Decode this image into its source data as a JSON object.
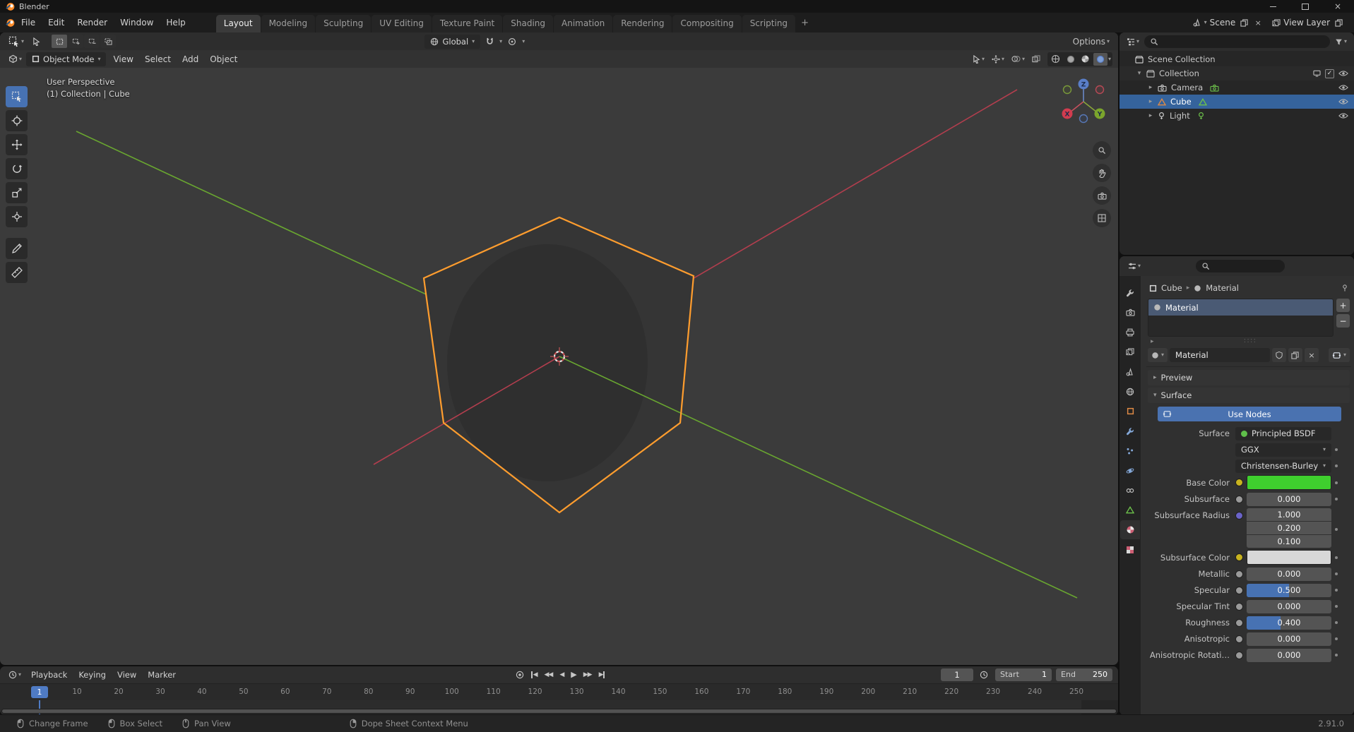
{
  "titlebar": {
    "app_title": "Blender"
  },
  "menubar": {
    "menus": [
      "File",
      "Edit",
      "Render",
      "Window",
      "Help"
    ],
    "workspaces": [
      "Layout",
      "Modeling",
      "Sculpting",
      "UV Editing",
      "Texture Paint",
      "Shading",
      "Animation",
      "Rendering",
      "Compositing",
      "Scripting"
    ],
    "active_workspace": "Layout",
    "add_workspace_label": "+",
    "scene_selector": {
      "value": "Scene"
    },
    "view_layer_selector": {
      "value": "View Layer"
    }
  },
  "tool_settings": {
    "orientation_label": "Global",
    "options_label": "Options"
  },
  "viewport": {
    "header": {
      "mode": "Object Mode",
      "menus": [
        "View",
        "Select",
        "Add",
        "Object"
      ]
    },
    "overlay_line1": "User Perspective",
    "overlay_line2": "(1) Collection | Cube",
    "gizmo_axes": {
      "x": "X",
      "y": "Y",
      "z": "Z"
    },
    "colors": {
      "background": "#3b3b3b",
      "selection_outline": "#ff9d2e",
      "axis_x": "#b33e4e",
      "axis_y": "#69a630",
      "cube_fill": "#353535"
    }
  },
  "toolbar_tools": [
    {
      "name": "select",
      "active": true
    },
    {
      "name": "cursor",
      "active": false
    },
    {
      "name": "move",
      "active": false
    },
    {
      "name": "rotate",
      "active": false
    },
    {
      "name": "scale",
      "active": false
    },
    {
      "name": "transform",
      "active": false
    },
    {
      "name": "annotate",
      "active": false
    },
    {
      "name": "measure",
      "active": false
    }
  ],
  "outliner": {
    "search_placeholder": "",
    "rows": [
      {
        "label": "Scene Collection",
        "icon": "scene-collection",
        "indent": 0,
        "disclosure": "",
        "selected": false,
        "checkbox": false,
        "screen": false,
        "eye": false
      },
      {
        "label": "Collection",
        "icon": "collection",
        "indent": 1,
        "disclosure": "▾",
        "selected": false,
        "checkbox": true,
        "screen": true,
        "eye": true
      },
      {
        "label": "Camera",
        "icon": "camera",
        "data_icon": "camera-data",
        "indent": 2,
        "disclosure": "▸",
        "selected": false,
        "checkbox": false,
        "screen": false,
        "eye": true
      },
      {
        "label": "Cube",
        "icon": "mesh",
        "data_icon": "mesh-data",
        "indent": 2,
        "disclosure": "▸",
        "selected": true,
        "checkbox": false,
        "screen": false,
        "eye": true
      },
      {
        "label": "Light",
        "icon": "light",
        "data_icon": "light-data",
        "indent": 2,
        "disclosure": "▸",
        "selected": false,
        "checkbox": false,
        "screen": false,
        "eye": true
      }
    ]
  },
  "properties": {
    "search_placeholder": "",
    "tabs": [
      {
        "name": "tool",
        "active": false
      },
      {
        "name": "render",
        "active": false
      },
      {
        "name": "output",
        "active": false
      },
      {
        "name": "view-layer",
        "active": false
      },
      {
        "name": "scene",
        "active": false
      },
      {
        "name": "world",
        "active": false
      },
      {
        "name": "object",
        "active": false
      },
      {
        "name": "modifiers",
        "active": false
      },
      {
        "name": "particles",
        "active": false
      },
      {
        "name": "physics",
        "active": false
      },
      {
        "name": "constraints",
        "active": false
      },
      {
        "name": "object-data",
        "active": false
      },
      {
        "name": "material",
        "active": true
      },
      {
        "name": "texture",
        "active": false
      }
    ],
    "breadcrumb": {
      "object": "Cube",
      "material": "Material"
    },
    "slot": {
      "name": "Material"
    },
    "datablock": {
      "name": "Material"
    },
    "sections": {
      "preview": "Preview",
      "surface": "Surface"
    },
    "use_nodes_label": "Use Nodes",
    "surface_row": {
      "label": "Surface",
      "value": "Principled BSDF"
    },
    "distribution": "GGX",
    "subsurface_method": "Christensen-Burley",
    "fields": [
      {
        "label": "Base Color",
        "type": "color",
        "swatch": "#3fcf2e",
        "socket": "#c8b31f"
      },
      {
        "label": "Subsurface",
        "type": "number",
        "value": "0.000",
        "socket": "#9a9a9a"
      },
      {
        "label": "Subsurface Radius",
        "type": "vector",
        "values": [
          "1.000",
          "0.200",
          "0.100"
        ],
        "socket": "#6a63c8"
      },
      {
        "label": "Subsurface Color",
        "type": "color",
        "swatch": "#d8d8d8",
        "socket": "#c8b31f"
      },
      {
        "label": "Metallic",
        "type": "number",
        "value": "0.000",
        "socket": "#9a9a9a"
      },
      {
        "label": "Specular",
        "type": "slider",
        "value": "0.500",
        "fill": 0.5,
        "socket": "#9a9a9a"
      },
      {
        "label": "Specular Tint",
        "type": "number",
        "value": "0.000",
        "socket": "#9a9a9a"
      },
      {
        "label": "Roughness",
        "type": "slider",
        "value": "0.400",
        "fill": 0.4,
        "socket": "#9a9a9a"
      },
      {
        "label": "Anisotropic",
        "type": "number",
        "value": "0.000",
        "socket": "#9a9a9a"
      },
      {
        "label": "Anisotropic Rotati…",
        "type": "number",
        "value": "0.000",
        "socket": "#9a9a9a"
      }
    ]
  },
  "timeline": {
    "menus": [
      "Playback",
      "Keying",
      "View",
      "Marker"
    ],
    "current_frame": "1",
    "start": {
      "label": "Start",
      "value": "1"
    },
    "end": {
      "label": "End",
      "value": "250"
    },
    "ticks": [
      1,
      10,
      20,
      30,
      40,
      50,
      60,
      70,
      80,
      90,
      100,
      110,
      120,
      130,
      140,
      150,
      160,
      170,
      180,
      190,
      200,
      210,
      220,
      230,
      240,
      250
    ]
  },
  "statusbar": {
    "hints": [
      {
        "label": "Change Frame",
        "mouse": "left"
      },
      {
        "label": "Box Select",
        "mouse": "left"
      },
      {
        "label": "Pan View",
        "mouse": "middle"
      },
      {
        "label": "Dope Sheet Context Menu",
        "mouse": "right"
      }
    ],
    "version": "2.91.0"
  }
}
